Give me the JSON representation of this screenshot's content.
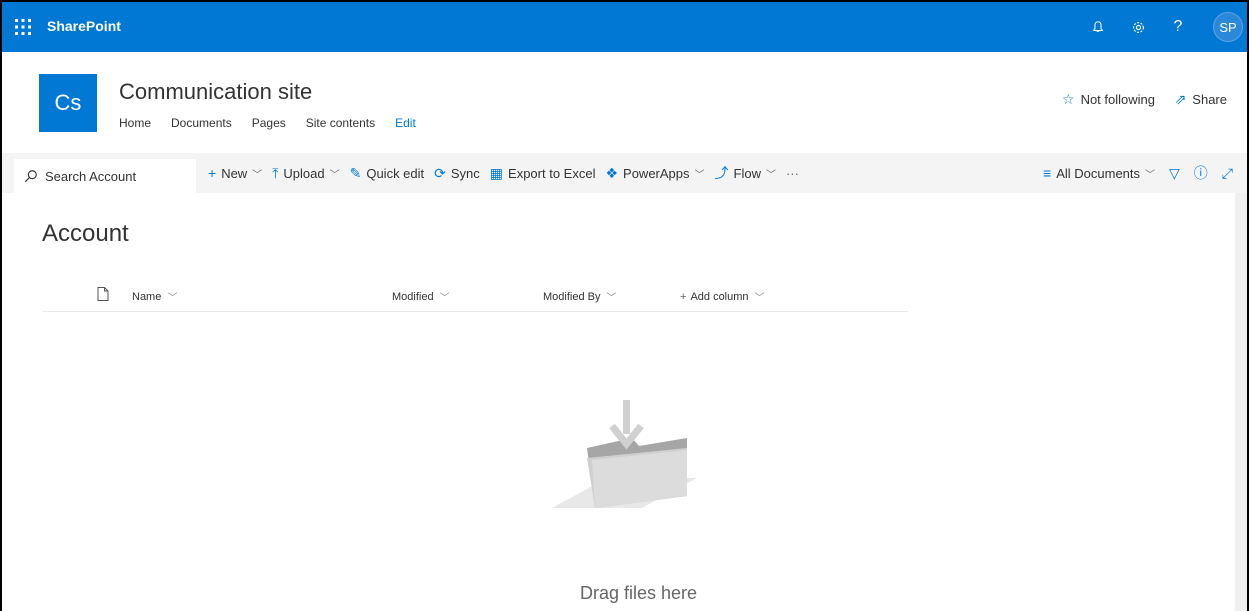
{
  "suitebar": {
    "brand": "SharePoint",
    "avatar_initials": "SP",
    "help_label": "?",
    "accent_color": "#0078d4"
  },
  "site": {
    "logo_initials": "Cs",
    "title": "Communication site",
    "nav": [
      "Home",
      "Documents",
      "Pages",
      "Site contents"
    ],
    "edit_label": "Edit",
    "follow_label": "Not following",
    "share_label": "Share"
  },
  "commandbar": {
    "search_label": "Search Account",
    "commands": {
      "new": "New",
      "upload": "Upload",
      "quick_edit": "Quick edit",
      "sync": "Sync",
      "export": "Export to Excel",
      "powerapps": "PowerApps",
      "flow": "Flow",
      "more": "···"
    },
    "view_label": "All Documents"
  },
  "library": {
    "title": "Account",
    "columns": {
      "name": "Name",
      "modified": "Modified",
      "modified_by": "Modified By",
      "add_column": "Add column"
    },
    "empty_text": "Drag files here"
  }
}
